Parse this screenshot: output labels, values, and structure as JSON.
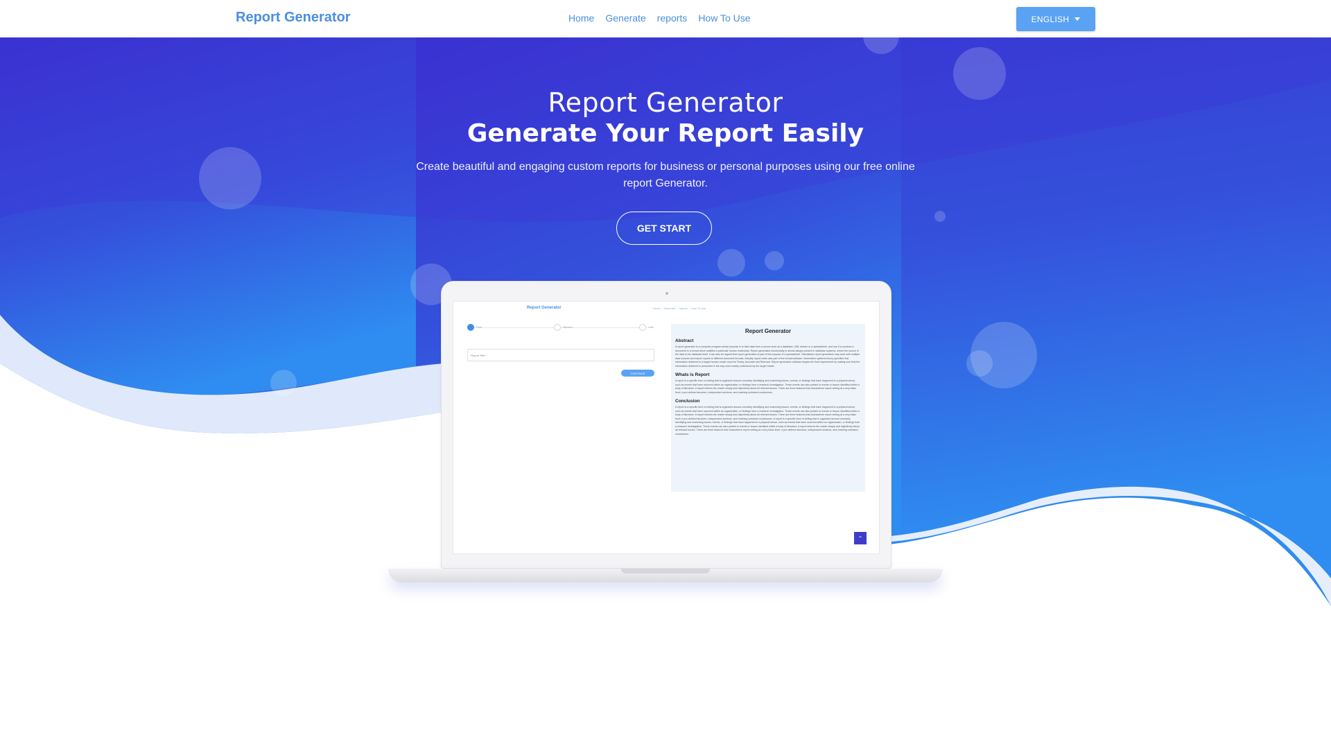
{
  "header": {
    "brand": "Report Generator",
    "nav": [
      "Home",
      "Generate",
      "reports",
      "How To Use"
    ],
    "language_label": "ENGLISH"
  },
  "hero": {
    "title": "Report Generator",
    "subtitle": "Generate Your Report Easily",
    "description": "Create beautiful and engaging custom reports for business or personal purposes using our free online report Generator.",
    "cta_label": "GET START"
  },
  "preview": {
    "brand": "Report Generator",
    "nav": [
      "Home",
      "Generate",
      "reports",
      "How To Use"
    ],
    "steps": [
      "First",
      "Second",
      "Last"
    ],
    "input_placeholder": "Report Title *",
    "continue_label": "CONTINUE",
    "panel": {
      "title": "Report Generator",
      "sections": [
        {
          "heading": "Abstract",
          "text": "A report generator is a computer program whose purpose is to take data from a source such as a database, XML stream or a spreadsheet, and use it to produce a document in a format which satisfies a particular human readership. Report generation functionality is almost always present in database systems, where the source of the data is the database itself. It can also be argued that report generation is part of the purpose of a spreadsheet. Standalone report generators may work with multiple data sources and export reports to different document formats. Actually report writer was part of the formal software. Information systems theory specifies that information delivered to a target human reader must be Timely, Accurate and Relevant. Report generation software targets the final requirement by making sure that the information delivered is presented in the way most readily understood by the target reader."
        },
        {
          "heading": "Whats is Report",
          "text": "A report is a specific form of writing that is organized around concisely identifying and examining issues, events, or findings that have happened in a physical sense, such as events that have occurred within an organization, or findings from a research investigation. These events can also pertain to events or issues identified within a body of literature. A report informs the reader simply and objectively about all relevant issues. There are three features that characterize report writing at a very basic level: a pre-defined structure, independent sections, and reaching unbiased conclusions."
        },
        {
          "heading": "Conclusion",
          "text": "A report is a specific form of writing that is organized around concisely identifying and examining issues, events, or findings that have happened in a physical sense, such as events that have occurred within an organization, or findings from a research investigation. These events can also pertain to events or issues identified within a body of literature. A report informs the reader simply and objectively about all relevant issues. There are three features that characterize report writing at a very basic level: a pre-defined structure, independent sections, and reaching unbiased conclusions. A report is a specific form of writing that is organized around concisely identifying and examining issues, events, or findings that have happened in a physical sense, such as events that have occurred within an organization, or findings from a research investigation. These events can also pertain to events or issues identified within a body of literature. A report informs the reader simply and objectively about all relevant issues. There are three features that characterize report writing at a very basic level: a pre-defined structure, independent sections, and reaching unbiased conclusions."
        }
      ]
    },
    "scroll_top_icon": "chevron-up-icon"
  },
  "colors": {
    "brand_blue": "#4a8fe0",
    "hero_top": "#3a2fce",
    "hero_bottom": "#2f8cf0",
    "button_blue": "#5aa2f3"
  }
}
